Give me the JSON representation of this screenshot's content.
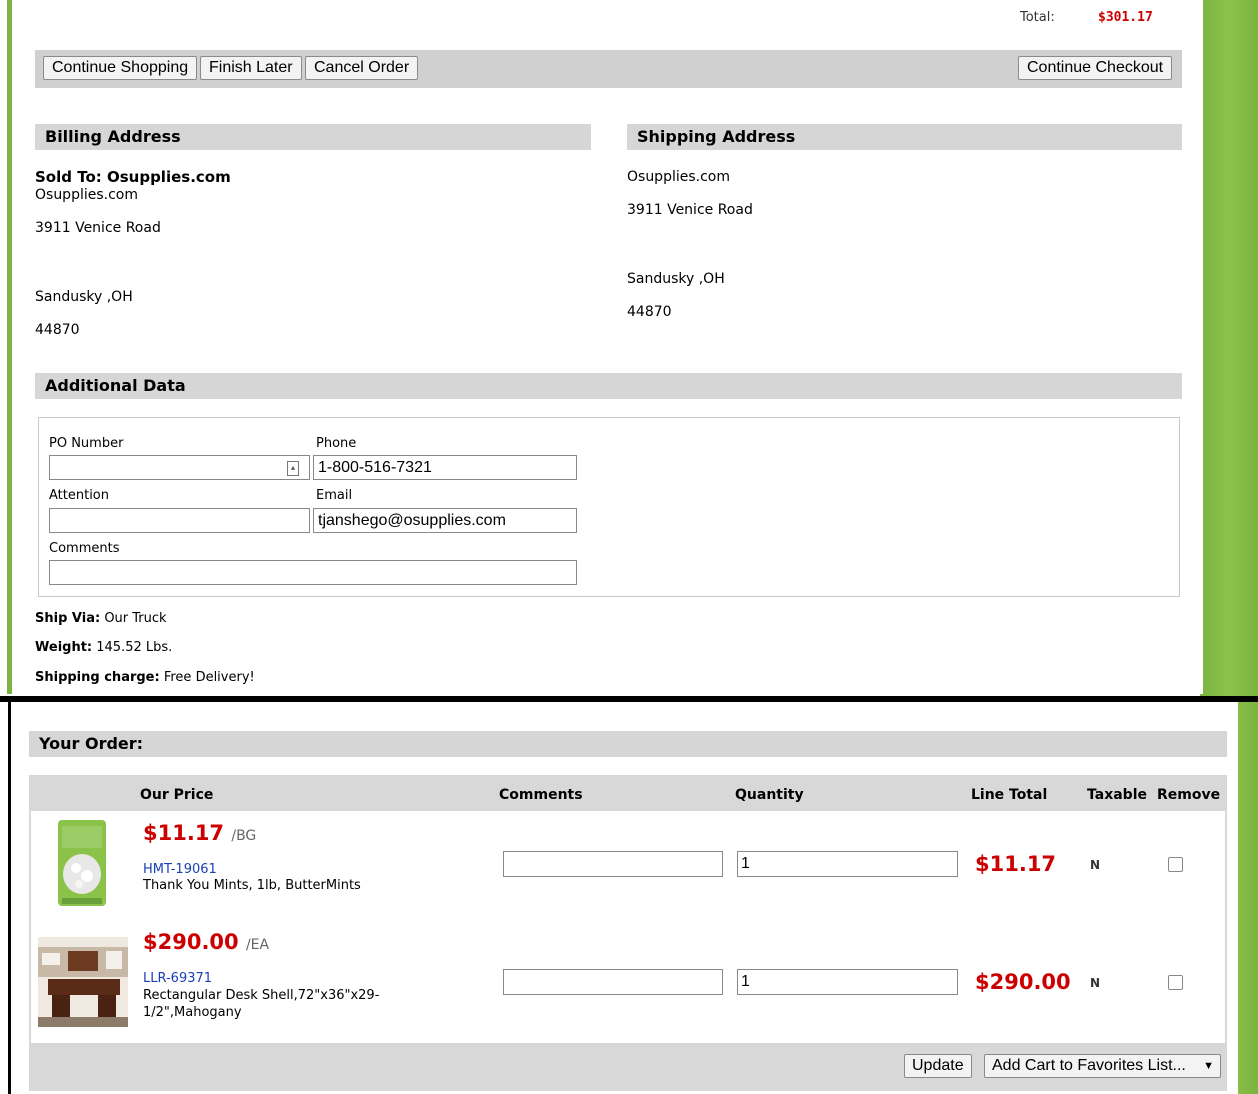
{
  "summary": {
    "total_label": "Total:",
    "total_value": "$301.17"
  },
  "toolbar": {
    "continue_shopping": "Continue Shopping",
    "finish_later": "Finish Later",
    "cancel_order": "Cancel Order",
    "continue_checkout": "Continue Checkout"
  },
  "billing": {
    "header": "Billing Address",
    "sold_to": "Sold To: Osupplies.com",
    "name": "Osupplies.com",
    "street": "3911 Venice Road",
    "city_state": "Sandusky ,OH",
    "zip": "44870"
  },
  "shipping": {
    "header": "Shipping Address",
    "name": "Osupplies.com",
    "street": "3911 Venice Road",
    "city_state": "Sandusky ,OH",
    "zip": "44870"
  },
  "additional": {
    "header": "Additional Data",
    "po_label": "PO Number",
    "po_value": "",
    "phone_label": "Phone",
    "phone_value": "1-800-516-7321",
    "attention_label": "Attention",
    "attention_value": "",
    "email_label": "Email",
    "email_value": "tjanshego@osupplies.com",
    "comments_label": "Comments",
    "comments_value": ""
  },
  "ship_info": {
    "ship_via_label": "Ship Via:",
    "ship_via_value": "Our Truck",
    "weight_label": "Weight:",
    "weight_value": "145.52 Lbs.",
    "charge_label": "Shipping charge:",
    "charge_value": "Free Delivery!"
  },
  "order": {
    "header": "Your Order:",
    "columns": {
      "price": "Our Price",
      "comments": "Comments",
      "quantity": "Quantity",
      "line_total": "Line Total",
      "taxable": "Taxable",
      "remove": "Remove"
    },
    "items": [
      {
        "price": "$11.17",
        "unit": "/BG",
        "sku": "HMT-19061",
        "desc": "Thank You Mints, 1lb, ButterMints",
        "comment": "",
        "qty": "1",
        "line_total": "$11.17",
        "taxable": "N"
      },
      {
        "price": "$290.00",
        "unit": "/EA",
        "sku": "LLR-69371",
        "desc1": "Rectangular Desk Shell,72\"x36\"x29-",
        "desc2": "1/2\",Mahogany",
        "comment": "",
        "qty": "1",
        "line_total": "$290.00",
        "taxable": "N"
      }
    ],
    "update": "Update",
    "favorites": "Add Cart to Favorites List..."
  },
  "colors": {
    "accent_green": "#7cb342",
    "price_red": "#cc0000",
    "link_blue": "#1a3fb5"
  }
}
